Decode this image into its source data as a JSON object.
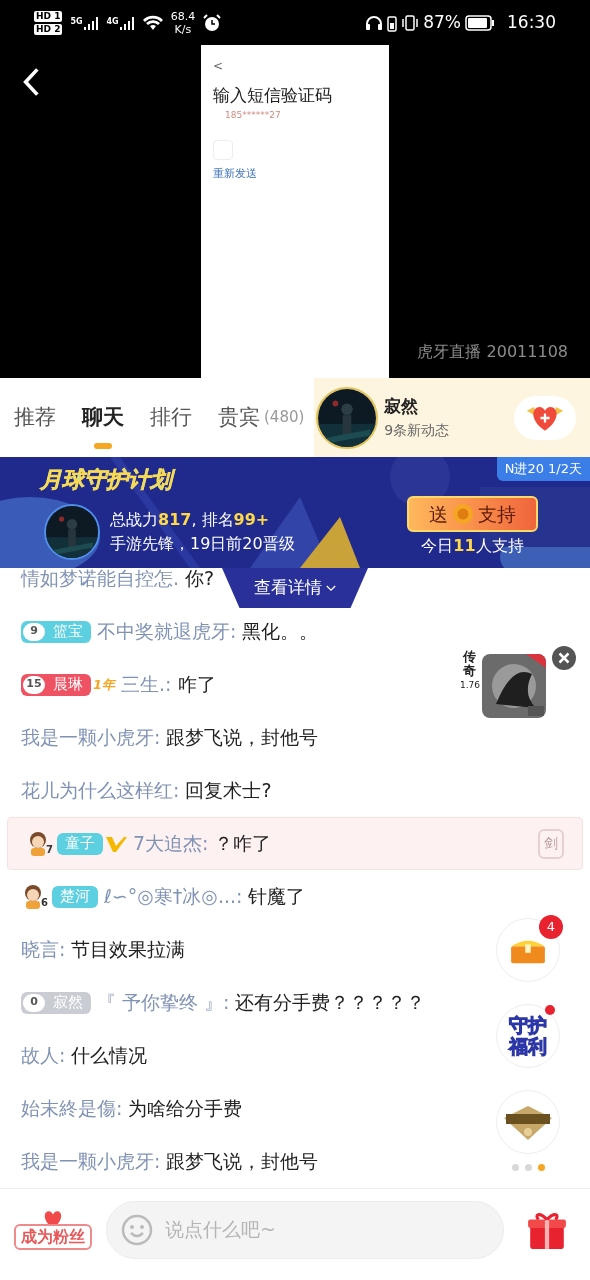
{
  "status_bar": {
    "sim_labels": [
      "HD 1",
      "HD 2"
    ],
    "networks": [
      "5G",
      "4G"
    ],
    "speed": "68.4",
    "speed_unit": "K/s",
    "battery": "87%",
    "time": "16:30"
  },
  "video": {
    "inner_screen": {
      "back": "<",
      "title": "输入短信验证码",
      "phone": "185******27",
      "resend": "重新发送"
    },
    "overlay_text": "虎牙直播 20011108"
  },
  "tabs": [
    {
      "label": "推荐",
      "selected": false
    },
    {
      "label": "聊天",
      "selected": true
    },
    {
      "label": "排行",
      "selected": false
    },
    {
      "label": "贵宾",
      "count": "(480)",
      "selected": false
    }
  ],
  "anchor": {
    "name": "寂然",
    "subtitle": "9条新动态"
  },
  "banner": {
    "title": "月球守护计划",
    "tag": "N进20 1/2天",
    "stats": [
      {
        "text": "总战力",
        "highlight": false
      },
      {
        "text": "817",
        "highlight": true
      },
      {
        "text": ", 排名",
        "highlight": false
      },
      {
        "text": "99+",
        "highlight": true
      }
    ],
    "subtitle": "手游先锋，19日前20晋级",
    "support_button": {
      "left": "送",
      "right": "支持"
    },
    "supporters": [
      {
        "text": "今日",
        "highlight": false
      },
      {
        "text": "11",
        "highlight": true
      },
      {
        "text": "人支持",
        "highlight": false
      }
    ],
    "details": "查看详情"
  },
  "chat": [
    {
      "name": "情如梦诺能自控怎.",
      "message": "你?",
      "highlighted": false
    },
    {
      "badge": {
        "kind": "fan",
        "level": "9",
        "name": "篮宝",
        "color": "#5ccfe0"
      },
      "name": "不中奖就退虎牙:",
      "message": "黑化。。",
      "highlighted": false
    },
    {
      "badge": {
        "kind": "fan",
        "level": "15",
        "name": "晨琳",
        "color": "#ef5363"
      },
      "year_badge": "1年",
      "name": "三生.:",
      "message": "咋了",
      "highlighted": false
    },
    {
      "name": "我是一颗小虎牙:",
      "message": "跟梦飞说，封他号",
      "highlighted": false
    },
    {
      "name": "花儿为什么这样红:",
      "message": "回复术士?",
      "highlighted": false
    },
    {
      "badge": {
        "kind": "avatar",
        "level": "7",
        "name": "童子",
        "color": "#5ccfe0"
      },
      "vip": true,
      "name": "7大迫杰:",
      "message": "？咋了",
      "highlighted": true,
      "medal": "剑"
    },
    {
      "badge": {
        "kind": "avatar",
        "level": "6",
        "name": "楚河",
        "color": "#5ccfe0"
      },
      "name": "ℓ∽°◎寒†冰◎...:",
      "message": "针魔了",
      "highlighted": false
    },
    {
      "name": "晓言:",
      "message": "节目效果拉满",
      "highlighted": false
    },
    {
      "badge": {
        "kind": "fan",
        "level": "0",
        "name": "寂然",
        "color": "#c9ccd3"
      },
      "name": "『 予你挚终 』:",
      "message": "还有分手费？？？？？",
      "highlighted": false
    },
    {
      "name": "故人:",
      "message": "什么情况",
      "highlighted": false
    },
    {
      "name": "始末終是傷:",
      "message": "为啥给分手费",
      "highlighted": false
    },
    {
      "name": "我是一颗小虎牙:",
      "message": "跟梦飞说，封他号",
      "highlighted": false
    }
  ],
  "ad": {
    "label": "传奇",
    "version": "1.76"
  },
  "widgets": [
    {
      "kind": "chest",
      "badge": "4"
    },
    {
      "kind": "guard",
      "text": "守护福利",
      "dot": true
    },
    {
      "kind": "emblem"
    }
  ],
  "pager": [
    {
      "selected": false
    },
    {
      "selected": false
    },
    {
      "selected": true
    }
  ],
  "bottom_bar": {
    "fan_button": "成为粉丝",
    "input": {
      "placeholder": "说点什么吧~"
    }
  }
}
